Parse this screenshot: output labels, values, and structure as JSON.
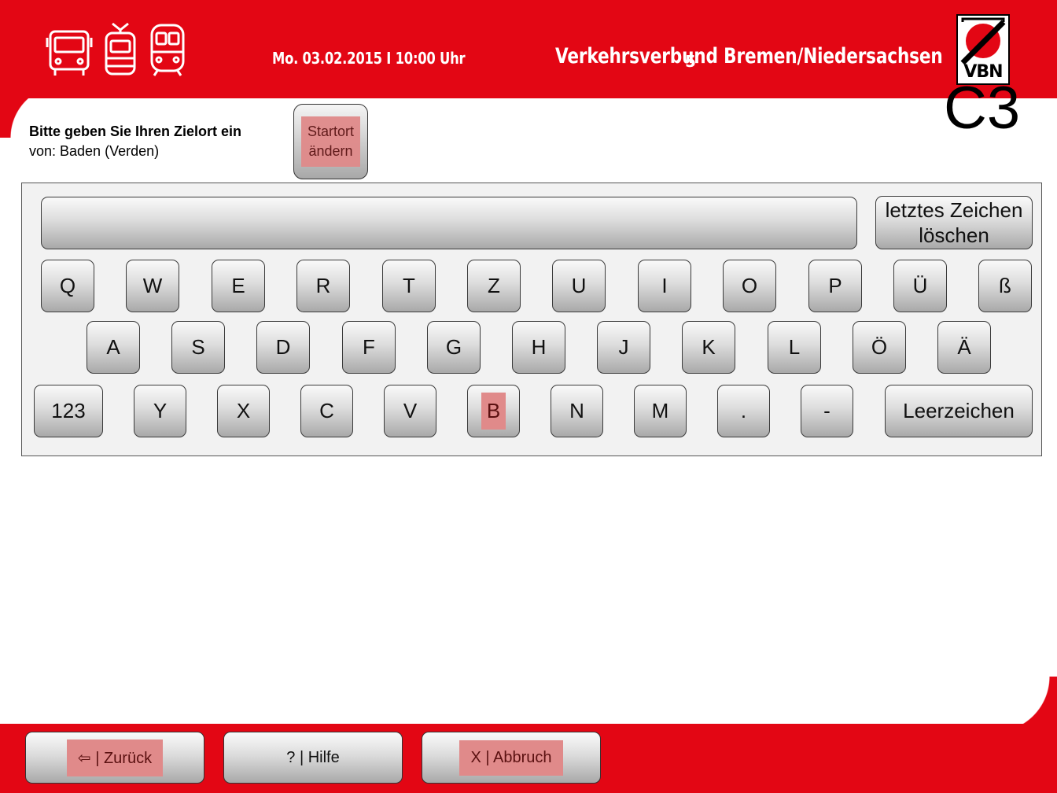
{
  "header": {
    "date_time": "Mo. 03.02.2015  I  10:00 Uhr",
    "organization": "Verkehrsverbund Bremen/Niedersachsen",
    "logo_text": "VBN",
    "screen_code": "C3",
    "step_number": "5"
  },
  "prompt": {
    "title": "Bitte geben Sie Ihren Zielort ein",
    "origin": "von: Baden (Verden)",
    "start_button_line1": "Startort",
    "start_button_line2": "ändern"
  },
  "keyboard": {
    "input_value": "",
    "backspace_line1": "letztes Zeichen",
    "backspace_line2": "löschen",
    "row1": [
      "Q",
      "W",
      "E",
      "R",
      "T",
      "Z",
      "U",
      "I",
      "O",
      "P",
      "Ü",
      "ß"
    ],
    "row2": [
      "A",
      "S",
      "D",
      "F",
      "G",
      "H",
      "J",
      "K",
      "L",
      "Ö",
      "Ä"
    ],
    "row3": [
      "123",
      "Y",
      "X",
      "C",
      "V",
      "B",
      "N",
      "M",
      ".",
      "-",
      "Leerzeichen"
    ],
    "highlighted_key": "B"
  },
  "footer": {
    "back_label": "⇦ | Zurück",
    "help_label": "? | Hilfe",
    "cancel_label": "X | Abbruch"
  },
  "colors": {
    "brand_red": "#e30614",
    "highlight": "#e08a8a"
  },
  "icons": [
    "bus-icon",
    "tram-icon",
    "train-icon"
  ]
}
